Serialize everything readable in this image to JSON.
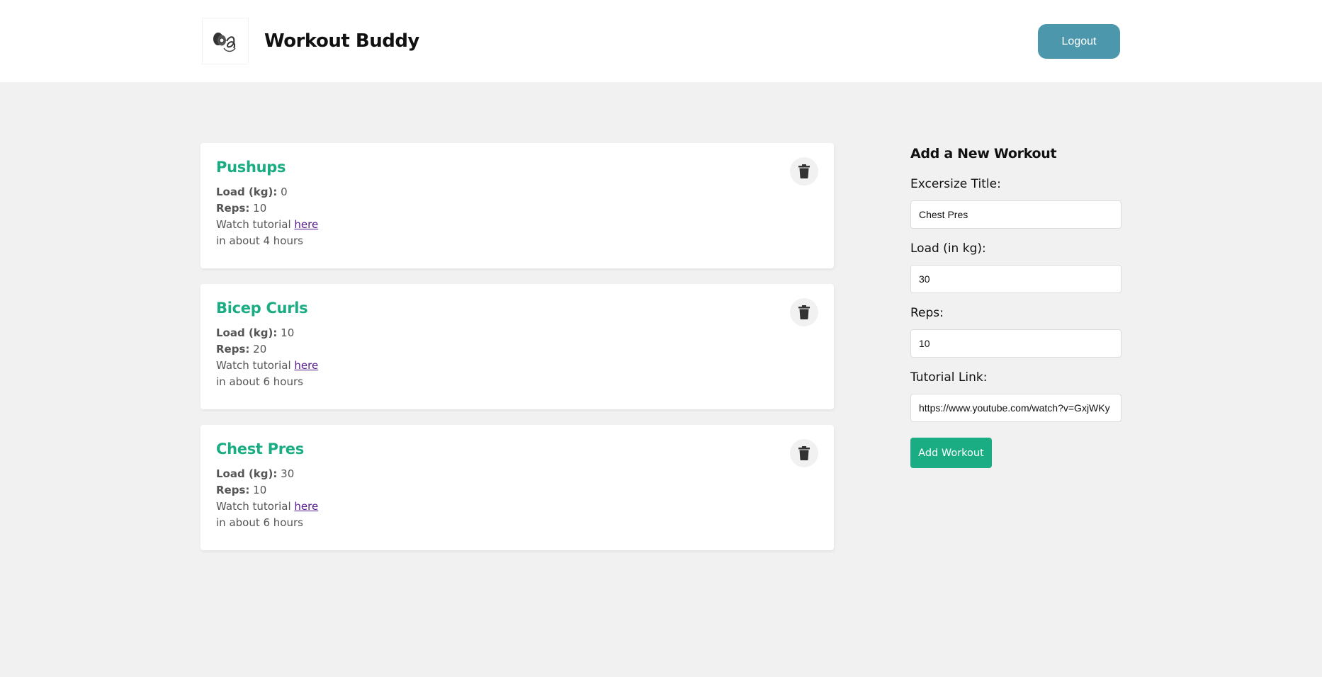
{
  "header": {
    "logo_icon": "dumbbell-logo-icon",
    "title": "Workout Buddy",
    "logout_label": "Logout"
  },
  "workouts": [
    {
      "title": "Pushups",
      "load_label": "Load (kg):",
      "load": "0",
      "reps_label": "Reps:",
      "reps": "10",
      "tutorial_prefix": "Watch tutorial",
      "tutorial_link_label": "here",
      "time": "in about 4 hours",
      "delete_icon": "trash-icon"
    },
    {
      "title": "Bicep Curls",
      "load_label": "Load (kg):",
      "load": "10",
      "reps_label": "Reps:",
      "reps": "20",
      "tutorial_prefix": "Watch tutorial",
      "tutorial_link_label": "here",
      "time": "in about 6 hours",
      "delete_icon": "trash-icon"
    },
    {
      "title": "Chest Pres",
      "load_label": "Load (kg):",
      "load": "30",
      "reps_label": "Reps:",
      "reps": "10",
      "tutorial_prefix": "Watch tutorial",
      "tutorial_link_label": "here",
      "time": "in about 6 hours",
      "delete_icon": "trash-icon"
    }
  ],
  "form": {
    "title": "Add a New Workout",
    "fields": {
      "title": {
        "label": "Excersize Title:",
        "value": "Chest Pres"
      },
      "load": {
        "label": "Load (in kg):",
        "value": "30"
      },
      "reps": {
        "label": "Reps:",
        "value": "10"
      },
      "tutorial": {
        "label": "Tutorial Link:",
        "value": "https://www.youtube.com/watch?v=GxjWKy"
      }
    },
    "submit_label": "Add Workout"
  },
  "colors": {
    "accent": "#1aac83",
    "logout": "#4d97ad",
    "background": "#f1f1f1",
    "link": "#551a8b"
  }
}
